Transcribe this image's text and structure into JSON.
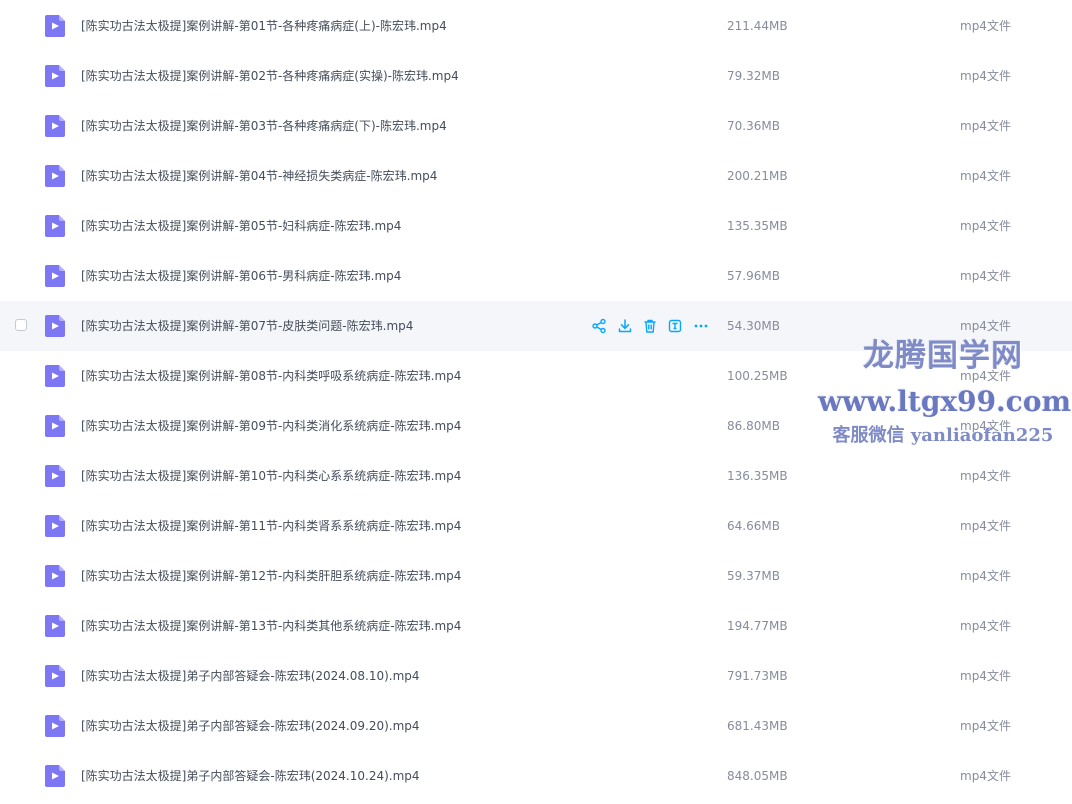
{
  "file_list": {
    "rows": [
      {
        "name": "[陈实功古法太极提]案例讲解-第01节-各种疼痛病症(上)-陈宏玮.mp4",
        "size": "211.44MB",
        "type": "mp4文件",
        "icon": "video-file-icon"
      },
      {
        "name": "[陈实功古法太极提]案例讲解-第02节-各种疼痛病症(实操)-陈宏玮.mp4",
        "size": "79.32MB",
        "type": "mp4文件",
        "icon": "video-file-icon"
      },
      {
        "name": "[陈实功古法太极提]案例讲解-第03节-各种疼痛病症(下)-陈宏玮.mp4",
        "size": "70.36MB",
        "type": "mp4文件",
        "icon": "video-file-icon"
      },
      {
        "name": "[陈实功古法太极提]案例讲解-第04节-神经损失类病症-陈宏玮.mp4",
        "size": "200.21MB",
        "type": "mp4文件",
        "icon": "video-file-icon"
      },
      {
        "name": "[陈实功古法太极提]案例讲解-第05节-妇科病症-陈宏玮.mp4",
        "size": "135.35MB",
        "type": "mp4文件",
        "icon": "video-file-icon"
      },
      {
        "name": "[陈实功古法太极提]案例讲解-第06节-男科病症-陈宏玮.mp4",
        "size": "57.96MB",
        "type": "mp4文件",
        "icon": "video-file-icon"
      },
      {
        "name": "[陈实功古法太极提]案例讲解-第07节-皮肤类问题-陈宏玮.mp4",
        "size": "54.30MB",
        "type": "mp4文件",
        "icon": "video-file-icon",
        "hovered": true
      },
      {
        "name": "[陈实功古法太极提]案例讲解-第08节-内科类呼吸系统病症-陈宏玮.mp4",
        "size": "100.25MB",
        "type": "mp4文件",
        "icon": "video-file-icon"
      },
      {
        "name": "[陈实功古法太极提]案例讲解-第09节-内科类消化系统病症-陈宏玮.mp4",
        "size": "86.80MB",
        "type": "mp4文件",
        "icon": "video-file-icon"
      },
      {
        "name": "[陈实功古法太极提]案例讲解-第10节-内科类心系系统病症-陈宏玮.mp4",
        "size": "136.35MB",
        "type": "mp4文件",
        "icon": "video-file-icon"
      },
      {
        "name": "[陈实功古法太极提]案例讲解-第11节-内科类肾系系统病症-陈宏玮.mp4",
        "size": "64.66MB",
        "type": "mp4文件",
        "icon": "video-file-icon"
      },
      {
        "name": "[陈实功古法太极提]案例讲解-第12节-内科类肝胆系统病症-陈宏玮.mp4",
        "size": "59.37MB",
        "type": "mp4文件",
        "icon": "video-file-icon"
      },
      {
        "name": "[陈实功古法太极提]案例讲解-第13节-内科类其他系统病症-陈宏玮.mp4",
        "size": "194.77MB",
        "type": "mp4文件",
        "icon": "video-file-icon"
      },
      {
        "name": "[陈实功古法太极提]弟子内部答疑会-陈宏玮(2024.08.10).mp4",
        "size": "791.73MB",
        "type": "mp4文件",
        "icon": "video-file-icon"
      },
      {
        "name": "[陈实功古法太极提]弟子内部答疑会-陈宏玮(2024.09.20).mp4",
        "size": "681.43MB",
        "type": "mp4文件",
        "icon": "video-file-icon"
      },
      {
        "name": "[陈实功古法太极提]弟子内部答疑会-陈宏玮(2024.10.24).mp4",
        "size": "848.05MB",
        "type": "mp4文件",
        "icon": "video-file-icon"
      }
    ],
    "hover_actions": [
      {
        "name": "share-icon"
      },
      {
        "name": "download-icon"
      },
      {
        "name": "delete-icon"
      },
      {
        "name": "rename-icon"
      },
      {
        "name": "more-icon"
      }
    ]
  },
  "watermark": {
    "title": "龙腾国学网",
    "url": "www.ltgx99.com",
    "contact": "客服微信 yanliaofan225"
  },
  "colors": {
    "icon_purple": "#7e77f4",
    "action_blue": "#06a7ff",
    "hover_background": "#f5f6fa",
    "watermark": "#7f8bc6"
  }
}
